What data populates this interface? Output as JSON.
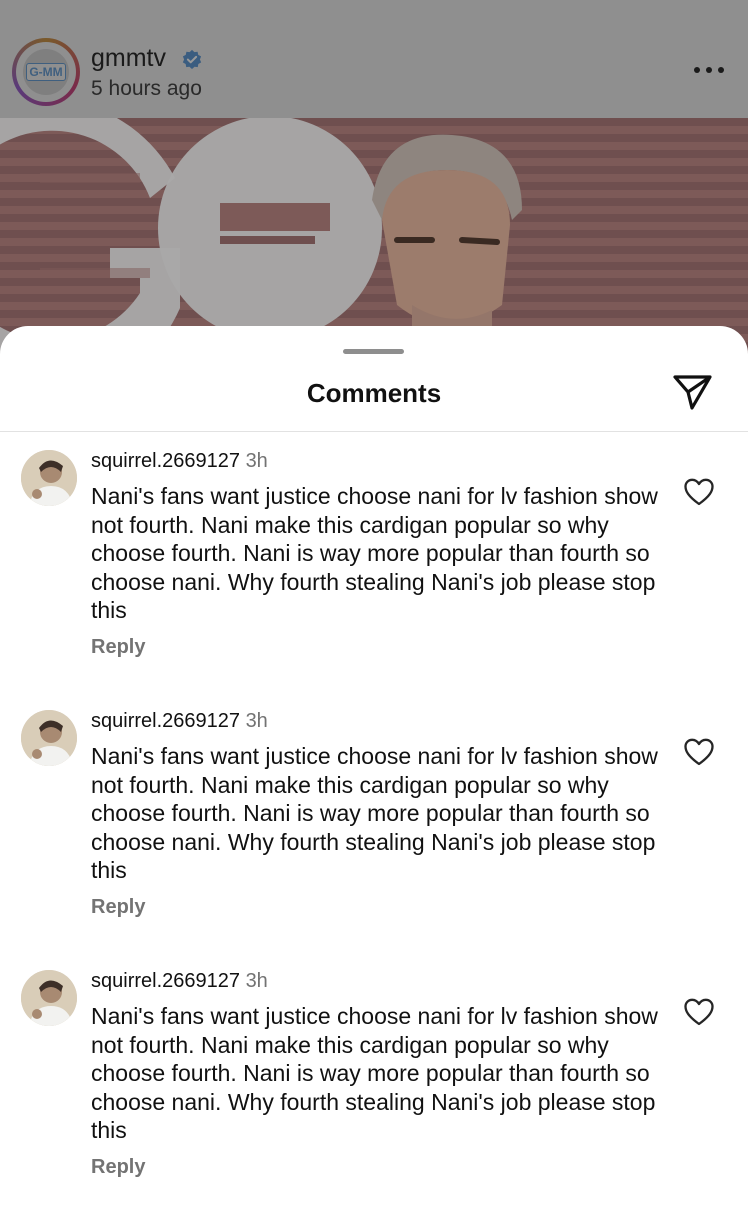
{
  "post": {
    "account": "gmmtv",
    "time": "5 hours ago",
    "avatar_text": "G-MM",
    "verified_color": "#3b5d80"
  },
  "sheet": {
    "title": "Comments"
  },
  "comments": [
    {
      "user": "squirrel.2669127",
      "time": "3h",
      "text": "Nani's fans want justice choose nani for lv fashion show not fourth.  Nani make this cardigan popular so why choose fourth.  Nani is way more popular than fourth so choose nani. Why fourth stealing Nani's job please stop this",
      "reply": "Reply"
    },
    {
      "user": "squirrel.2669127",
      "time": "3h",
      "text": "Nani's fans want justice choose nani for lv fashion show not fourth.  Nani make this cardigan popular so why choose fourth.  Nani is way more popular than fourth so choose nani. Why fourth stealing Nani's job please stop this",
      "reply": "Reply"
    },
    {
      "user": "squirrel.2669127",
      "time": "3h",
      "text": "Nani's fans want justice choose nani for lv fashion show not fourth.  Nani make this cardigan popular so why choose fourth.  Nani is way more popular than fourth so choose nani. Why fourth stealing Nani's job please stop this",
      "reply": "Reply"
    }
  ],
  "icons": {
    "more": "more-icon",
    "verified": "verified-badge-icon",
    "share": "send-icon",
    "like": "heart-icon"
  }
}
